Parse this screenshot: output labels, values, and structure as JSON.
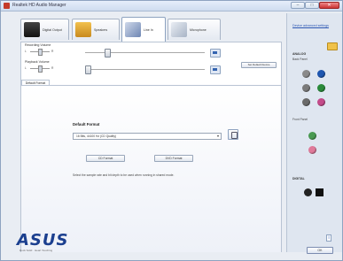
{
  "window": {
    "title": "Realtek HD Audio Manager",
    "min_glyph": "–",
    "max_glyph": "□",
    "close_glyph": "✕"
  },
  "tabs": [
    {
      "label": "Digital Output"
    },
    {
      "label": "Speakers"
    },
    {
      "label": "Line In"
    },
    {
      "label": "Microphone"
    }
  ],
  "recording_volume": {
    "label": "Recording Volume",
    "left": "L",
    "right": "R"
  },
  "playback_volume": {
    "label": "Playback Volume",
    "left": "L",
    "right": "R"
  },
  "set_default_label": "Set Default Device",
  "inner_tab": "Default Format",
  "default_format": {
    "title": "Default Format",
    "selected": "16 Bits, 44100 Hz (CD Quality)",
    "arrow": "▾",
    "cd_button": "CD Format",
    "dvd_button": "DVD Format",
    "help": "Select the sample rate and bit depth to be used when running in shared mode."
  },
  "right_panel": {
    "device_link": "Device advanced settings",
    "analog": "ANALOG",
    "back_panel": "Back Panel",
    "front_panel": "Front Panel",
    "digital": "DIGITAL"
  },
  "jack_colors": {
    "back": [
      [
        "#8a8a8a",
        "#1e56b0"
      ],
      [
        "#7a7a7a",
        "#2a8a3a"
      ],
      [
        "#6a6a6a",
        "#c44b8a"
      ]
    ],
    "front": [
      "#4a9a52",
      "#e07a9a"
    ]
  },
  "brand": {
    "logo": "ASUS",
    "tagline": "Rock Solid · Heart Touching"
  },
  "info_glyph": "i",
  "ok_label": "OK"
}
